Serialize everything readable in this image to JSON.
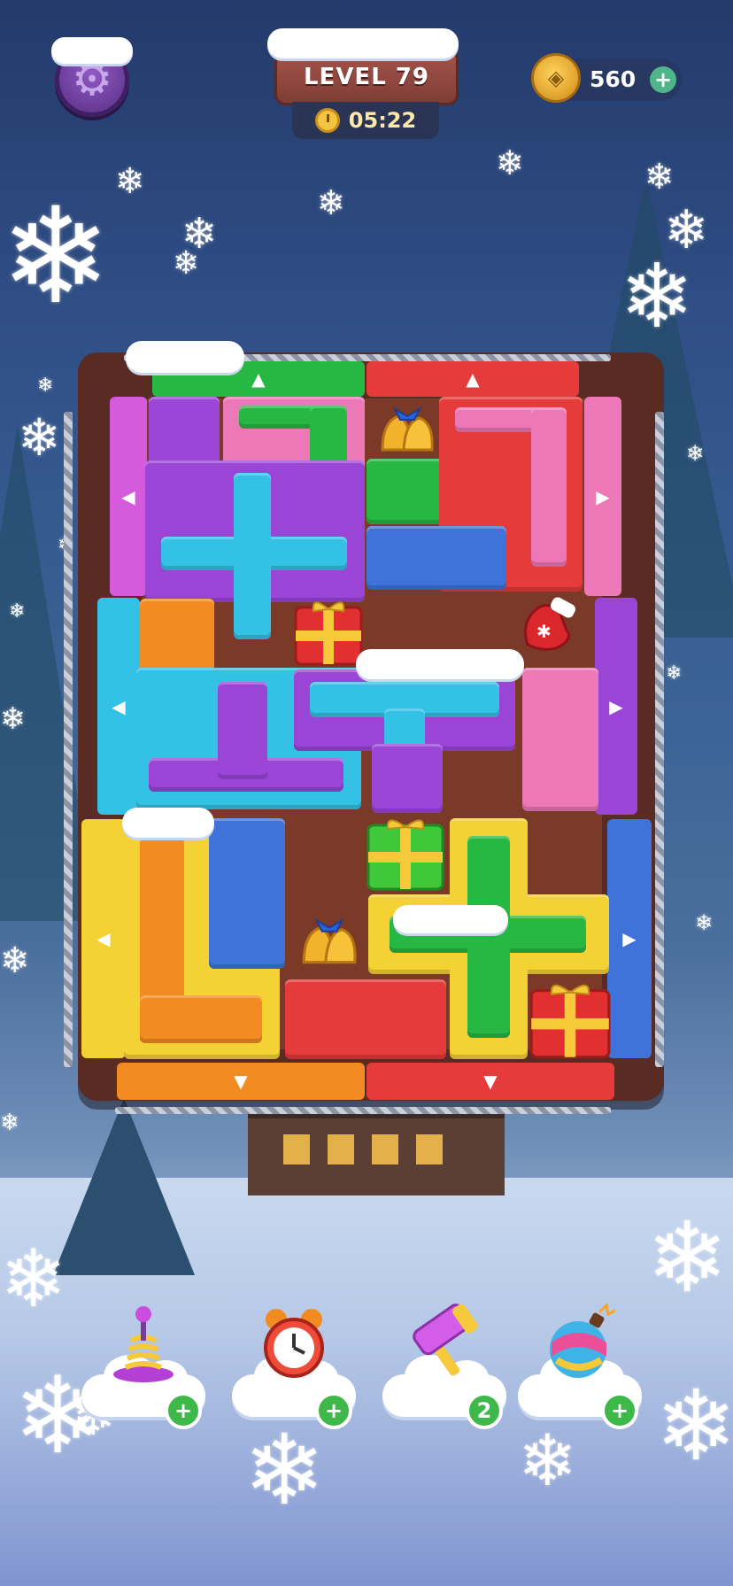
{
  "header": {
    "level_label": "LEVEL 79",
    "timer": "05:22",
    "coins": "560",
    "coin_plus": "+"
  },
  "boosters": [
    {
      "name": "spring-booster",
      "badge": "+"
    },
    {
      "name": "alarm-clock-booster",
      "badge": "+"
    },
    {
      "name": "hammer-booster",
      "badge": "2"
    },
    {
      "name": "bomb-booster",
      "badge": "+"
    }
  ],
  "colors": {
    "green": "#27b843",
    "red": "#e63b3b",
    "purple": "#9b45d6",
    "pink": "#ec78b8",
    "cyan": "#33c2e6",
    "blue": "#3f73d9",
    "orange": "#f28c22",
    "yellow": "#f5d234"
  },
  "icons": {
    "settings": "gear-icon",
    "timer": "clock-icon",
    "coin": "coin-icon",
    "gift": "gift-icon",
    "bells": "bells-icon",
    "mitten": "mitten-icon"
  }
}
